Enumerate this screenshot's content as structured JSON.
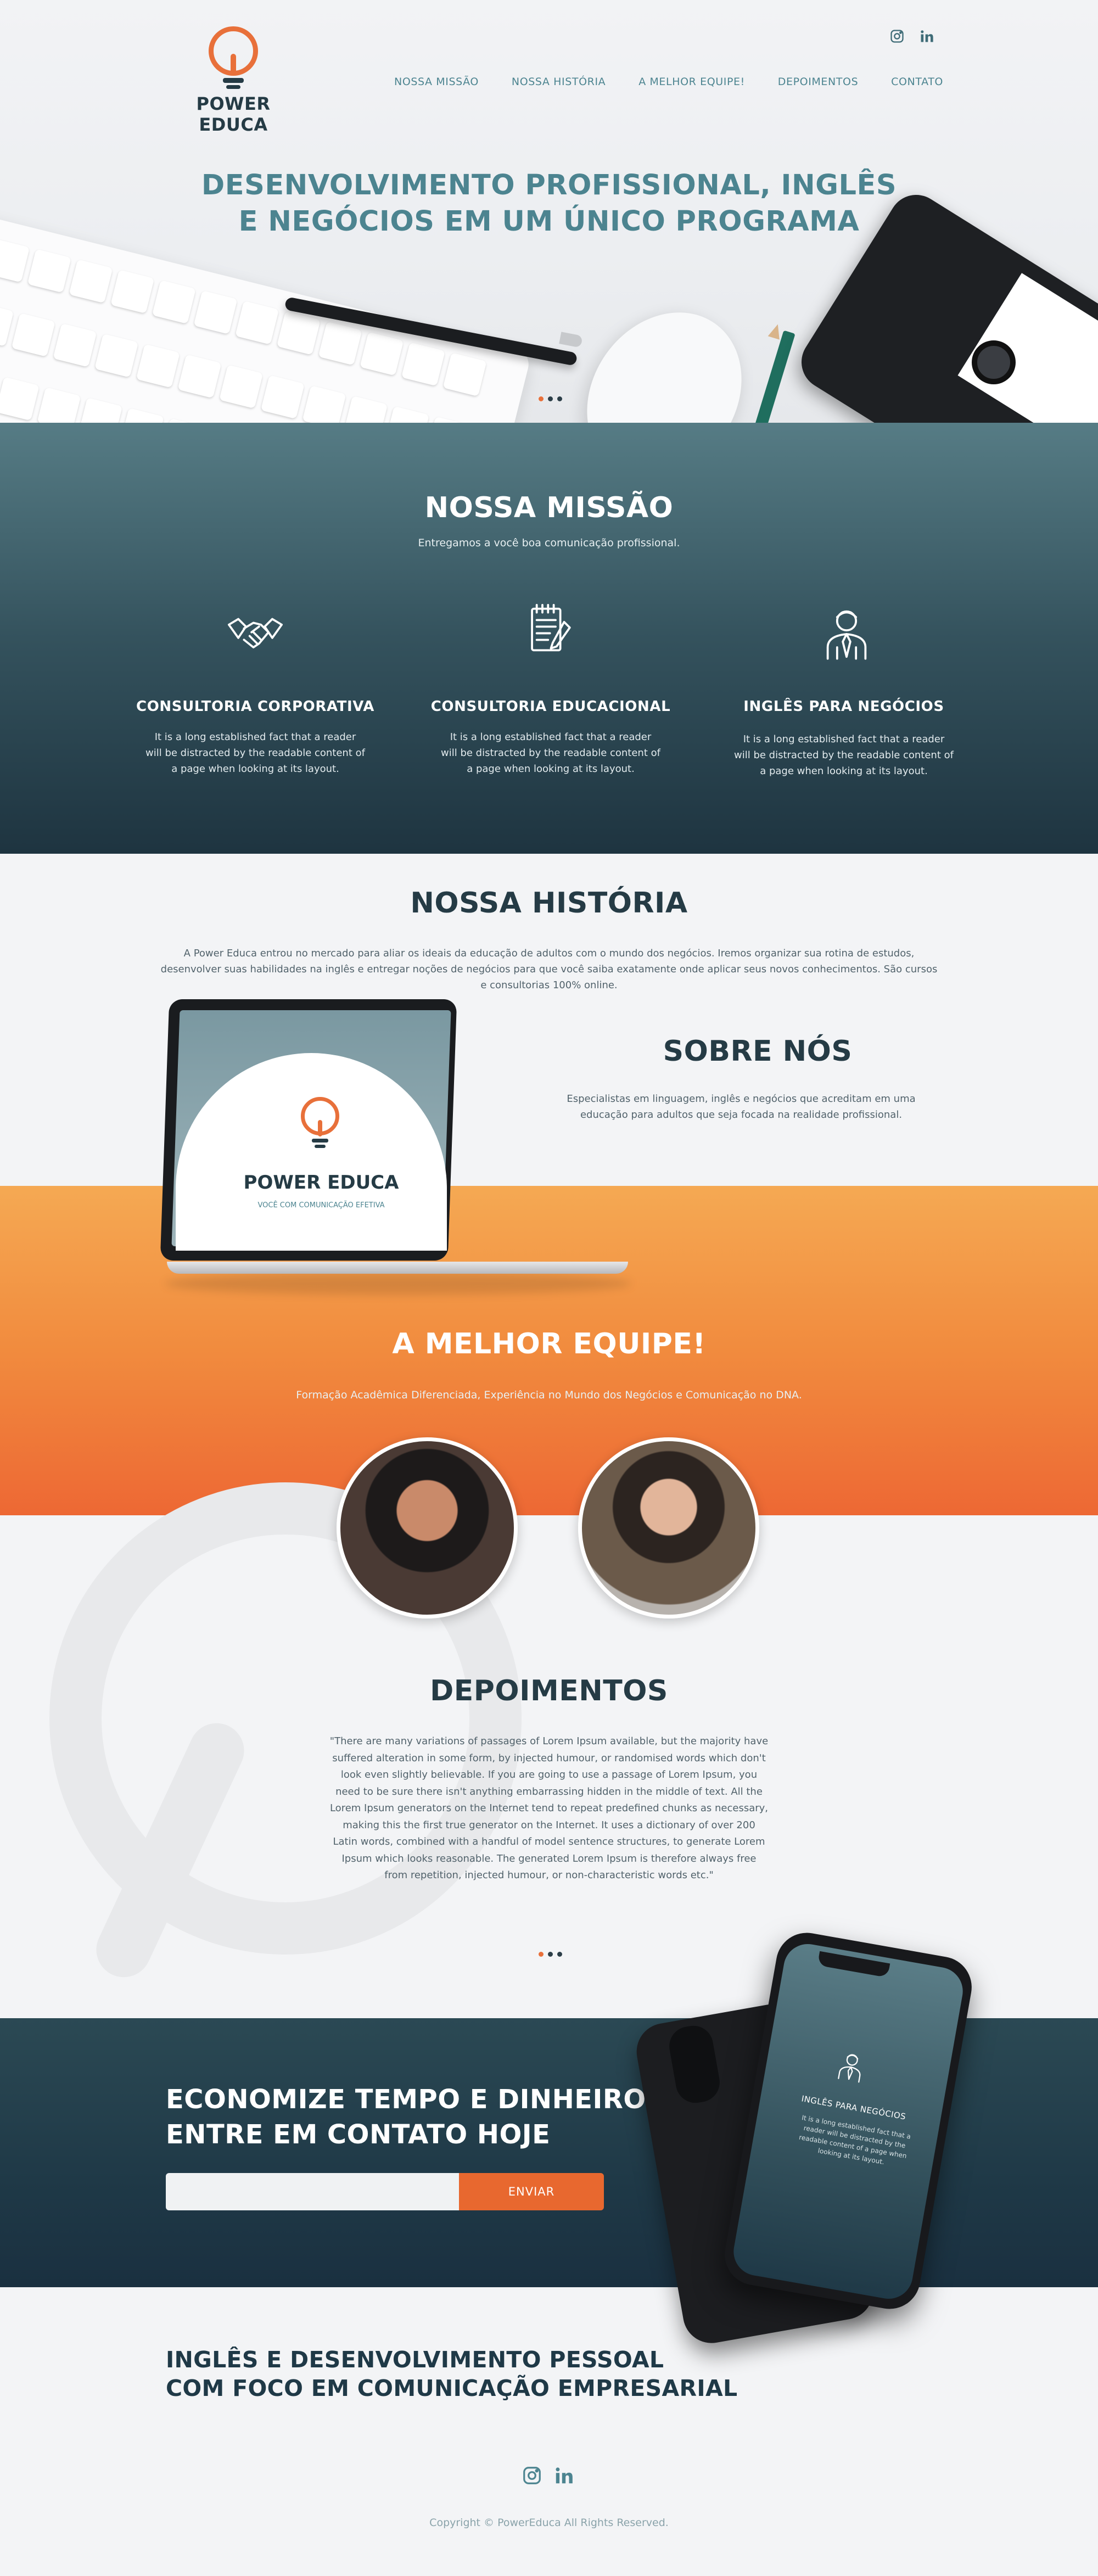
{
  "brand": {
    "name": "POWER EDUCA"
  },
  "social": {
    "instagram_icon": "instagram-icon",
    "linkedin_icon": "linkedin-icon"
  },
  "nav": {
    "items": [
      "NOSSA MISSÃO",
      "NOSSA HISTÓRIA",
      "A MELHOR EQUIPE!",
      "DEPOIMENTOS",
      "CONTATO"
    ]
  },
  "hero": {
    "title_line1": "DESENVOLVIMENTO PROFISSIONAL, INGLÊS",
    "title_line2": "E NEGÓCIOS EM UM ÚNICO PROGRAMA",
    "slider_dots": 3,
    "active_dot": 0
  },
  "missao": {
    "title": "NOSSA MISSÃO",
    "subtitle": "Entregamos a você boa comunicação profissional.",
    "features": [
      {
        "icon": "handshake-icon",
        "title": "CONSULTORIA CORPORATIVA",
        "text": "It is a long established fact that a reader will be distracted by the readable content of a page when looking at its layout."
      },
      {
        "icon": "document-pen-icon",
        "title": "CONSULTORIA EDUCACIONAL",
        "text": "It is a long established fact that a reader will be distracted by the readable content of a page when looking at its layout."
      },
      {
        "icon": "businessman-icon",
        "title": "INGLÊS PARA NEGÓCIOS",
        "text": "It is a long established fact that a reader will be distracted by the readable content of a page when looking at its layout."
      }
    ]
  },
  "historia": {
    "title": "NOSSA HISTÓRIA",
    "text": "A Power Educa entrou no mercado para aliar os ideais da educação de adultos com o mundo dos negócios. Iremos organizar sua rotina de estudos, desenvolver suas habilidades na inglês e entregar noções de negócios para que você saiba exatamente onde aplicar seus novos conhecimentos. São cursos e consultorias 100% online."
  },
  "sobre": {
    "title": "SOBRE NÓS",
    "text": "Especialistas em linguagem, inglês e negócios que acreditam em uma educação para adultos que seja focada na realidade profissional."
  },
  "laptop": {
    "brand": "POWER EDUCA",
    "slogan": "VOCÊ COM COMUNICAÇÃO EFETIVA"
  },
  "equipe": {
    "title": "A MELHOR EQUIPE!",
    "subtitle": "Formação Acadêmica Diferenciada, Experiência no Mundo dos Negócios e Comunicação no DNA."
  },
  "depoimentos": {
    "title": "DEPOIMENTOS",
    "quote": "\"There are many variations of passages of Lorem Ipsum available, but the majority have suffered alteration in some form, by injected humour, or randomised words which don't look even slightly believable. If you are going to use a passage of Lorem Ipsum, you need to be sure there isn't anything embarrassing hidden in the middle of text. All the Lorem Ipsum generators on the Internet tend to repeat predefined chunks as necessary, making this the first true generator on the Internet. It uses a dictionary of over 200 Latin words, combined with a handful of model sentence structures, to generate Lorem Ipsum which looks reasonable. The generated Lorem Ipsum is therefore always free from repetition, injected humour, or non-characteristic words etc.\"",
    "slider_dots": 3,
    "active_dot": 0
  },
  "contato": {
    "title_line1": "ECONOMIZE TEMPO E DINHEIRO",
    "title_line2": "ENTRE EM CONTATO HOJE",
    "email_value": "",
    "send_label": "ENVIAR"
  },
  "phone": {
    "title": "INGLÊS PARA NEGÓCIOS",
    "text": "It is a long established fact that a reader will be distracted by the readable content of a page when looking at its layout."
  },
  "footer": {
    "tagline_line1": "INGLÊS E DESENVOLVIMENTO PESSOAL",
    "tagline_line2": "COM FOCO EM COMUNICAÇÃO EMPRESARIAL",
    "copyright": "Copyright © PowerEduca All Rights Reserved."
  },
  "colors": {
    "accent": "#e8703a",
    "teal": "#4c8490",
    "dark": "#1f3947",
    "orange_gradient_top": "#f5a953",
    "orange_gradient_bottom": "#ed6834"
  }
}
